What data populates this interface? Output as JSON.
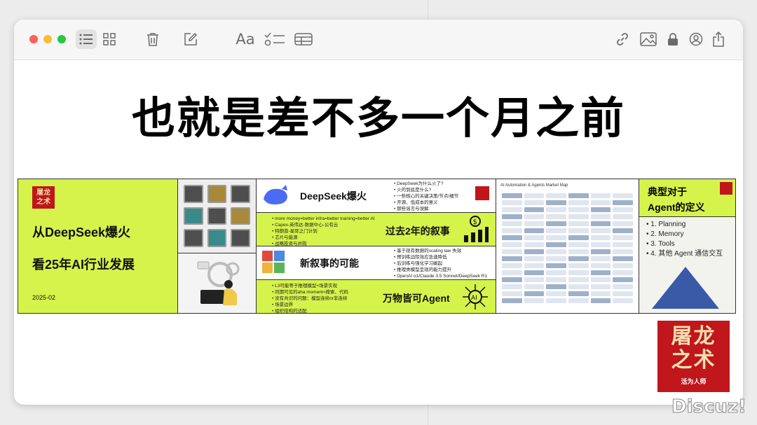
{
  "window": {
    "toolbar": {
      "icons": [
        "list-view-icon",
        "grid-view-icon",
        "trash-icon",
        "compose-icon",
        "format-text-icon",
        "checklist-icon",
        "table-icon",
        "link-icon",
        "image-icon",
        "lock-icon",
        "collaborate-icon",
        "share-icon"
      ],
      "format_label": "Aa"
    }
  },
  "note": {
    "title": "也就是差不多一个月之前"
  },
  "collage": {
    "panel_a": {
      "seal": "屠龙\n之术",
      "line1": "从DeepSeek爆火",
      "line2": "看25年AI行业发展",
      "date": "2025-02"
    },
    "panel_c": {
      "row1_title": "DeepSeek爆火",
      "row1_items": [
        "DeepSeek为什么火了?",
        "火的到底是什么?",
        "一些核心的关键决策/节点/细节",
        "开源、低成本的意义",
        "那些谣言与误解"
      ],
      "row2_title": "过去2年的叙事",
      "row2_items": [
        "more money=better infra=better training=better AI",
        "Capex-英伟达-数据中心-公有云",
        "特朗普-星际之门计划",
        "芯片与能源",
        "战略投资与并购"
      ],
      "row3_title": "新叙事的可能",
      "row3_items": [
        "基于现有数据的scaling law 失效",
        "预训练边际效应急速降低",
        "后训练与强化学习崛起",
        "推理类模型呈现的能力提升",
        "OpenAI o1/Claude 3.5 Sonnet/DeepSeek R1"
      ],
      "row4_title": "万物皆可Agent",
      "row4_items": [
        "L3可能等于推理模型+场景实现",
        "同期可见的aha moment=搜索、代码",
        "没有共识的问题：模型连续or非连续",
        "场景边界",
        "组织结构的适配"
      ]
    },
    "panel_d": {
      "title": "AI Automation & Agents Market Map"
    },
    "panel_e": {
      "title1": "典型对于",
      "title2": "Agent的定义",
      "items": [
        "1. Planning",
        "2. Memory",
        "3. Tools",
        "4. 其他 Agent 通信交互"
      ]
    }
  },
  "logo": {
    "line1": "屠龙",
    "line2": "之术",
    "line3": "活为人师"
  },
  "watermark": "Discuz!"
}
